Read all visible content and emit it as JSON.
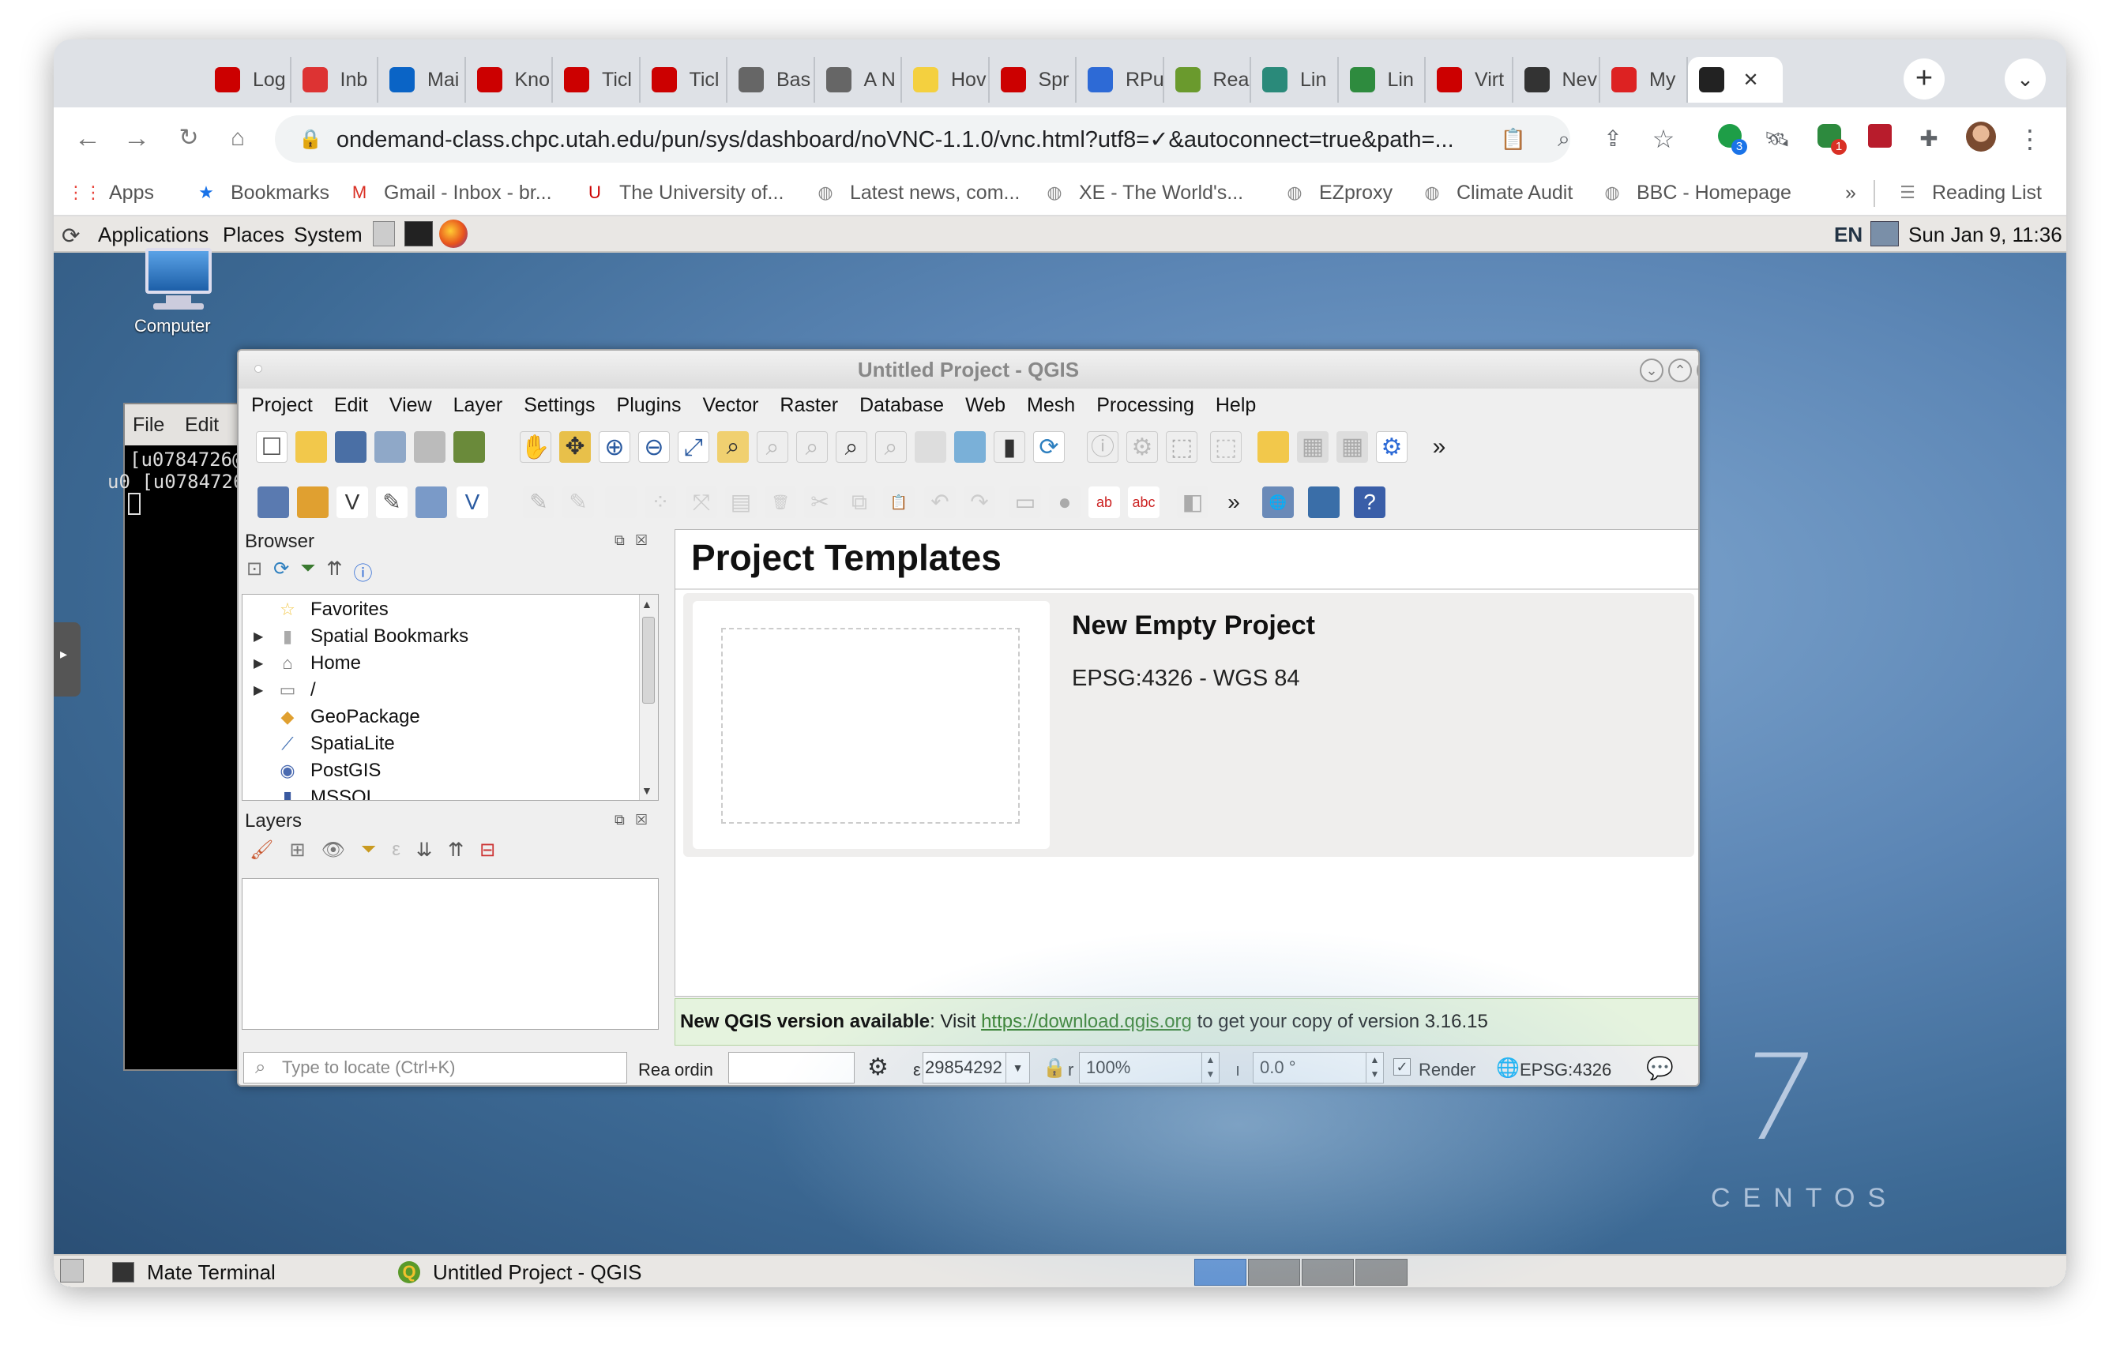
{
  "browser": {
    "tabs": [
      {
        "label": "Log",
        "icon": "utah-icon",
        "color": "#cc0000"
      },
      {
        "label": "Inb",
        "icon": "cog-red-icon",
        "color": "#d33"
      },
      {
        "label": "Mai",
        "icon": "outlook-icon",
        "color": "#0a64c6"
      },
      {
        "label": "Kno",
        "icon": "utah-icon",
        "color": "#cc0000"
      },
      {
        "label": "Ticl",
        "icon": "utah-icon",
        "color": "#cc0000"
      },
      {
        "label": "Ticl",
        "icon": "utah-icon",
        "color": "#cc0000"
      },
      {
        "label": "Bas",
        "icon": "globe-icon",
        "color": "#666"
      },
      {
        "label": "A N",
        "icon": "globe-icon",
        "color": "#666"
      },
      {
        "label": "Hov",
        "icon": "note-icon",
        "color": "#f4d03f"
      },
      {
        "label": "Spr",
        "icon": "utah-icon",
        "color": "#cc0000"
      },
      {
        "label": "RPu",
        "icon": "r-icon",
        "color": "#2d6ad6"
      },
      {
        "label": "Rea",
        "icon": "leaf-icon",
        "color": "#6a9a2d"
      },
      {
        "label": "Lin",
        "icon": "gear-green-icon",
        "color": "#2a8a7a"
      },
      {
        "label": "Lin",
        "icon": "leaf-icon",
        "color": "#2e8b3e"
      },
      {
        "label": "Virt",
        "icon": "utah-icon",
        "color": "#cc0000"
      },
      {
        "label": "Nev",
        "icon": "github-icon",
        "color": "#333"
      },
      {
        "label": "My",
        "icon": "arrow-red-icon",
        "color": "#d22"
      },
      {
        "label": "",
        "icon": "vnc-icon",
        "color": "#222",
        "active": true
      }
    ],
    "close_tab_glyph": "✕",
    "new_tab_glyph": "+",
    "tab_menu_glyph": "⌄",
    "url": "ondemand-class.chpc.utah.edu/pun/sys/dashboard/noVNC-1.1.0/vnc.html?utf8=✓&autoconnect=true&path=...",
    "extension_badges": [
      "3",
      "1"
    ],
    "bookmarks": [
      "Apps",
      "Bookmarks",
      "Gmail - Inbox - br...",
      "The University of...",
      "Latest news, com...",
      "XE - The World's...",
      "EZproxy",
      "Climate Audit",
      "BBC - Homepage"
    ],
    "bookmarks_overflow": "»",
    "reading_list": "Reading List"
  },
  "desktop": {
    "panel_menus": [
      "Applications",
      "Places",
      "System"
    ],
    "keyboard": "EN",
    "clock": "Sun Jan  9, 11:36",
    "computer_label": "Computer",
    "terminal": {
      "menu": [
        "File",
        "Edit"
      ],
      "lines": [
        "[u0784726@",
        "u0 [u0784726@"
      ]
    },
    "taskbar": [
      "Mate Terminal",
      "Untitled Project - QGIS"
    ],
    "brand_number": "7",
    "brand_name": "CENTOS"
  },
  "qgis": {
    "title": "Untitled Project - QGIS",
    "menu": [
      "Project",
      "Edit",
      "View",
      "Layer",
      "Settings",
      "Plugins",
      "Vector",
      "Raster",
      "Database",
      "Web",
      "Mesh",
      "Processing",
      "Help"
    ],
    "browser_panel": {
      "title": "Browser",
      "items": [
        {
          "label": "Favorites",
          "expandable": false,
          "icon": "star-icon"
        },
        {
          "label": "Spatial Bookmarks",
          "expandable": true,
          "icon": "bookmark-icon"
        },
        {
          "label": "Home",
          "expandable": true,
          "icon": "home-icon"
        },
        {
          "label": "/",
          "expandable": true,
          "icon": "folder-icon"
        },
        {
          "label": "GeoPackage",
          "expandable": false,
          "icon": "geopackage-icon"
        },
        {
          "label": "SpatiaLite",
          "expandable": false,
          "icon": "spatialite-icon"
        },
        {
          "label": "PostGIS",
          "expandable": false,
          "icon": "postgis-icon"
        },
        {
          "label": "MSSQL",
          "expandable": false,
          "icon": "mssql-icon"
        }
      ]
    },
    "layers_panel": {
      "title": "Layers"
    },
    "templates": {
      "heading": "Project Templates",
      "card_name": "New Empty Project",
      "card_crs": "EPSG:4326 - WGS 84"
    },
    "message": {
      "bold": "New QGIS version available",
      "prefix": ": Visit ",
      "link": "https://download.qgis.org",
      "suffix": " to get your copy of version 3.16.15"
    },
    "status": {
      "locate_placeholder": "Type to locate (Ctrl+K)",
      "ready_label": "Rea",
      "coord_label": "ordin",
      "coordinate": "",
      "scale_label": "ε",
      "scale": "29854292",
      "magnifier_label": "r",
      "magnifier": "100%",
      "rotation_label": "ı",
      "rotation": "0.0 °",
      "render_label": "Render",
      "crs": "EPSG:4326"
    }
  }
}
